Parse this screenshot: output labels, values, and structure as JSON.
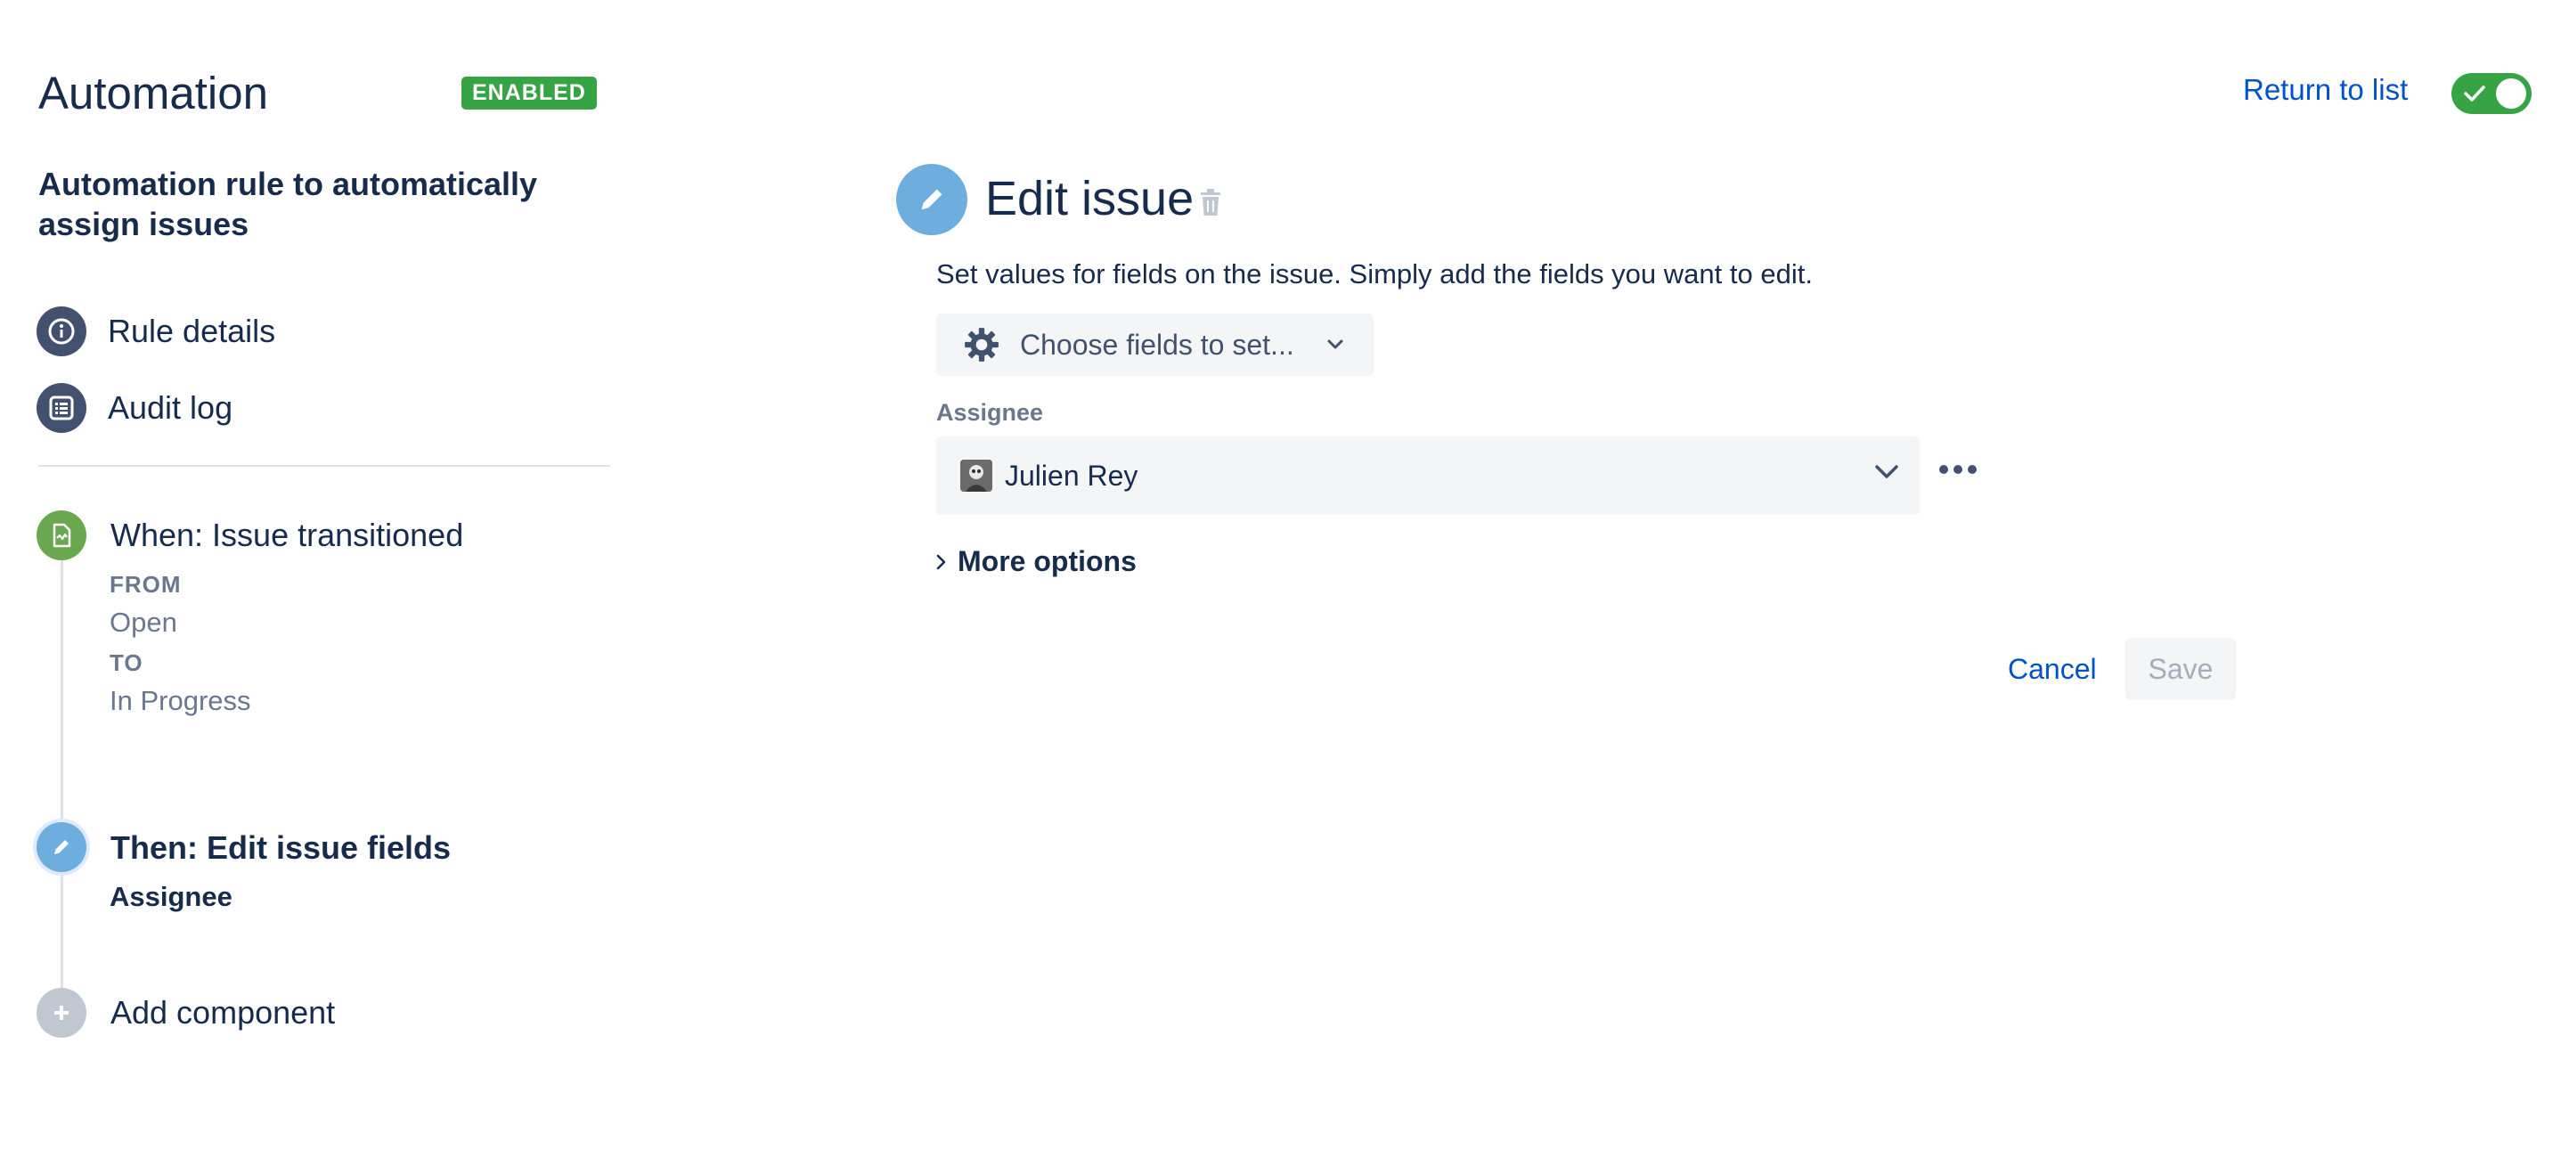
{
  "header": {
    "title": "Automation",
    "status_badge": "ENABLED",
    "return_link": "Return to list",
    "toggle_state": "on"
  },
  "rule": {
    "name": "Automation rule to automatically assign issues"
  },
  "nav": {
    "items": [
      {
        "label": "Rule details",
        "icon": "info-icon"
      },
      {
        "label": "Audit log",
        "icon": "list-icon"
      }
    ]
  },
  "timeline": {
    "trigger": {
      "title": "When: Issue transitioned",
      "from_label": "FROM",
      "from_value": "Open",
      "to_label": "TO",
      "to_value": "In Progress",
      "color": "#6aa84f"
    },
    "action": {
      "title": "Then: Edit issue fields",
      "subtitle": "Assignee",
      "color": "#6eaede"
    },
    "add": {
      "label": "Add component",
      "color": "#c1c7d0"
    }
  },
  "editor": {
    "title": "Edit issue",
    "description": "Set values for fields on the issue. Simply add the fields you want to edit.",
    "choose_fields_label": "Choose fields to set...",
    "field_label": "Assignee",
    "field_value": "Julien Rey",
    "more_options_label": "More options",
    "cancel_label": "Cancel",
    "save_label": "Save"
  },
  "colors": {
    "enabled_green": "#36a345",
    "link_blue": "#0052cc",
    "nav_icon_bg": "#42526e",
    "text_primary": "#172b4d",
    "text_subtle": "#6b778c"
  }
}
